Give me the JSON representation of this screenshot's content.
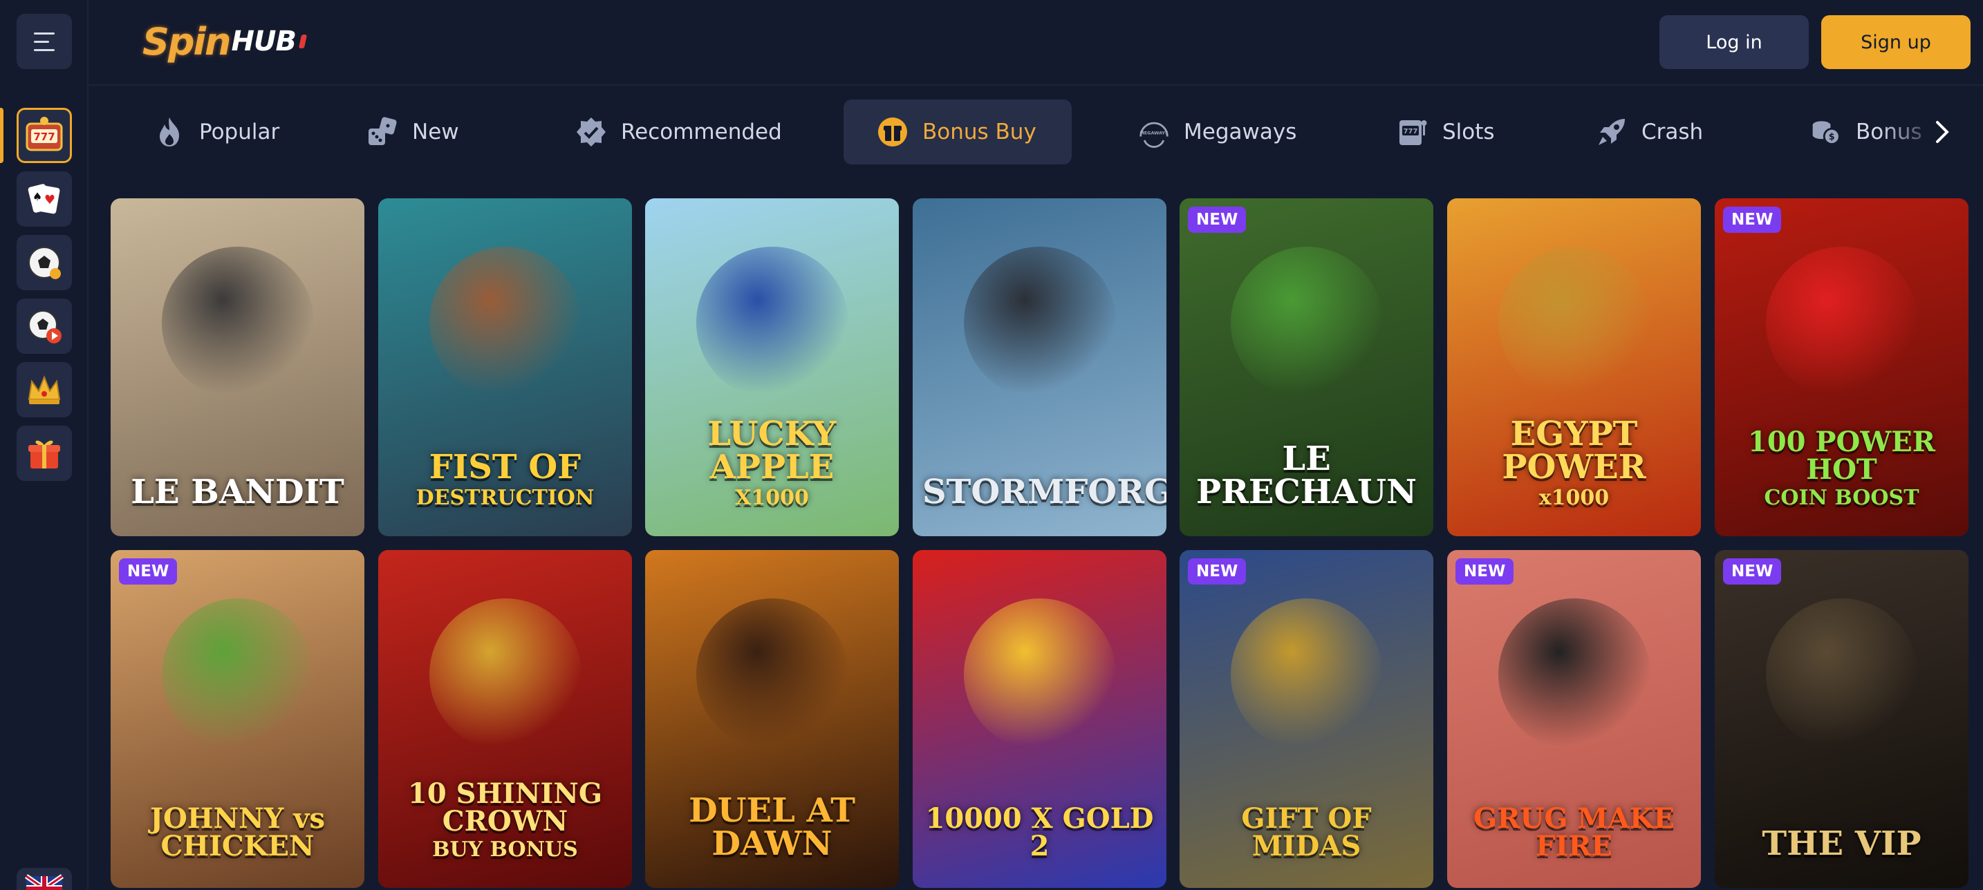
{
  "header": {
    "logo": {
      "part1": "Spin",
      "part2": "HUB"
    },
    "login_label": "Log in",
    "signup_label": "Sign up"
  },
  "sidebar": {
    "menu_icon": "hamburger-icon",
    "items": [
      {
        "icon": "slot-777-icon",
        "active": true
      },
      {
        "icon": "playing-cards-icon",
        "active": false
      },
      {
        "icon": "soccer-ball-icon",
        "active": false
      },
      {
        "icon": "soccer-live-icon",
        "active": false
      },
      {
        "icon": "crown-icon",
        "active": false
      },
      {
        "icon": "gift-icon",
        "active": false
      }
    ],
    "language_icon": "uk-flag-icon"
  },
  "tabs": [
    {
      "label": "Popular",
      "icon": "fire-icon",
      "active": false
    },
    {
      "label": "New",
      "icon": "dice-icon",
      "active": false
    },
    {
      "label": "Recommended",
      "icon": "badge-icon",
      "active": false
    },
    {
      "label": "Bonus Buy",
      "icon": "bonus-buy-icon",
      "active": true
    },
    {
      "label": "Megaways",
      "icon": "megaways-icon",
      "active": false
    },
    {
      "label": "Slots",
      "icon": "slot-machine-icon",
      "active": false
    },
    {
      "label": "Crash",
      "icon": "rocket-icon",
      "active": false
    },
    {
      "label": "Bonus",
      "icon": "coins-icon",
      "active": false
    }
  ],
  "games": [
    {
      "title": "LE BANDIT",
      "sub": "",
      "badge": "",
      "bg": [
        "#c9b79a",
        "#7e6a55"
      ],
      "color": "#ffffff",
      "art": "#3c3a3a"
    },
    {
      "title": "FIST OF",
      "sub": "DESTRUCTION",
      "badge": "",
      "bg": [
        "#2d8c96",
        "#2a3d4f"
      ],
      "color": "#ffcf3a",
      "art": "#9a5c38"
    },
    {
      "title": "LUCKY APPLE",
      "sub": "X1000",
      "badge": "",
      "bg": [
        "#9fd3f0",
        "#7cb870"
      ],
      "color": "#ffd24a",
      "art": "#2a4fa8"
    },
    {
      "title": "STORMFORGED",
      "sub": "",
      "badge": "",
      "bg": [
        "#3e6f95",
        "#8fb4cf"
      ],
      "color": "#e8edf3",
      "art": "#2c3038"
    },
    {
      "title": "LE PRECHAUN",
      "sub": "",
      "badge": "NEW",
      "bg": [
        "#3f6b2c",
        "#1f3a1a"
      ],
      "color": "#ffffff",
      "art": "#4a9a35"
    },
    {
      "title": "EGYPT POWER",
      "sub": "x1000",
      "badge": "",
      "bg": [
        "#e8a030",
        "#b82a10"
      ],
      "color": "#ffd95a",
      "art": "#c49230"
    },
    {
      "title": "100 POWER HOT",
      "sub": "COIN BOOST",
      "badge": "NEW",
      "bg": [
        "#b81c10",
        "#5a0c08"
      ],
      "color": "#8ee84a",
      "art": "#e02020"
    },
    {
      "title": "JOHNNY vs CHICKEN",
      "sub": "",
      "badge": "NEW",
      "bg": [
        "#d7a36a",
        "#6a3f24"
      ],
      "color": "#ffd24a",
      "art": "#5ea23a"
    },
    {
      "title": "10 SHINING CROWN",
      "sub": "BUY BONUS",
      "badge": "",
      "bg": [
        "#c4261c",
        "#5a0a0a"
      ],
      "color": "#ffe07a",
      "art": "#d4a530"
    },
    {
      "title": "DUEL AT DAWN",
      "sub": "",
      "badge": "",
      "bg": [
        "#d2781e",
        "#2a140a"
      ],
      "color": "#ffb534",
      "art": "#3a2012"
    },
    {
      "title": "10000 X GOLD 2",
      "sub": "",
      "badge": "",
      "bg": [
        "#d8201c",
        "#2a3ab0"
      ],
      "color": "#ffd84a",
      "art": "#f0c030"
    },
    {
      "title": "GIFT OF MIDAS",
      "sub": "",
      "badge": "NEW",
      "bg": [
        "#2c4a8a",
        "#7a6a38"
      ],
      "color": "#f5c63a",
      "art": "#c4992c"
    },
    {
      "title": "GRUG MAKE FIRE",
      "sub": "",
      "badge": "NEW",
      "bg": [
        "#d97a6c",
        "#b8554a"
      ],
      "color": "#ff5a1c",
      "art": "#222222"
    },
    {
      "title": "THE VIP",
      "sub": "",
      "badge": "NEW",
      "bg": [
        "#3a3028",
        "#120e0a"
      ],
      "color": "#e8c77a",
      "art": "#5a4a34"
    }
  ]
}
